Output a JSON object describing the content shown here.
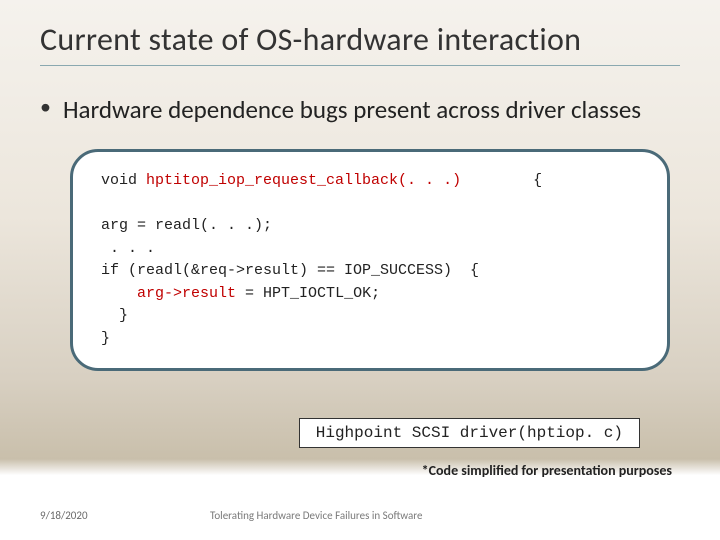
{
  "title": "Current state of OS-hardware interaction",
  "bullet": "Hardware dependence bugs present across driver classes",
  "code": {
    "l1a": "void ",
    "l1b": "hptitop_iop_request_callback(. . .)",
    "l1c": "        {",
    "blank": " ",
    "l2": "arg = readl(. . .);",
    "l3": " . . .",
    "l4": "if (readl(&req->result) == IOP_SUCCESS)  {",
    "l5a": "    ",
    "l5b": "arg->result",
    "l5c": " = HPT_IOCTL_OK;",
    "l6": "  }",
    "l7": "}"
  },
  "label": "Highpoint SCSI driver(hptiop. c)",
  "footnote": "*Code simplified for presentation purposes",
  "date": "9/18/2020",
  "footer": "Tolerating Hardware Device Failures in Software"
}
